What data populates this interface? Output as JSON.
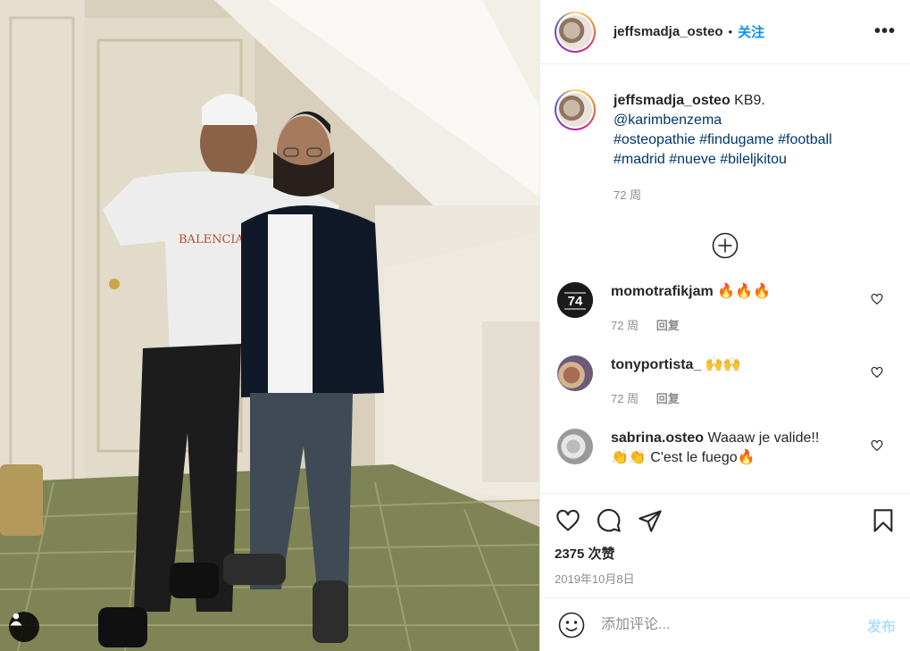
{
  "post": {
    "author": "jeffsmadja_osteo",
    "separator": "•",
    "follow_label": "关注",
    "more_label": "•••"
  },
  "caption": {
    "username": "jeffsmadja_osteo",
    "text": "KB9.",
    "mention": "@karimbenzema",
    "hashtags_line1": "#osteopathie #findugame #football",
    "hashtags_line2": "#madrid #nueve #bileljkitou",
    "time": "72 周"
  },
  "comments": [
    {
      "username": "momotrafikjam",
      "text": "🔥🔥🔥",
      "time": "72 周",
      "reply_label": "回复"
    },
    {
      "username": "tonyportista_",
      "text": "🙌🙌",
      "time": "72 周",
      "reply_label": "回复"
    },
    {
      "username": "sabrina.osteo",
      "text": "Waaaw je valide!!",
      "text2": "👏👏 C'est le fuego🔥"
    }
  ],
  "footer": {
    "likes": "2375 次赞",
    "date": "2019年10月8日"
  },
  "add_comment": {
    "placeholder": "添加评论...",
    "post_label": "发布"
  },
  "colors": {
    "link": "#00376b",
    "follow": "#0095f6",
    "muted": "#8e8e8e",
    "post_disabled": "#b2dffc"
  },
  "icons": [
    "heart-icon",
    "comment-icon",
    "share-icon",
    "bookmark-icon",
    "emoji-icon",
    "plus-circle-icon",
    "user-tag-icon",
    "more-icon"
  ]
}
